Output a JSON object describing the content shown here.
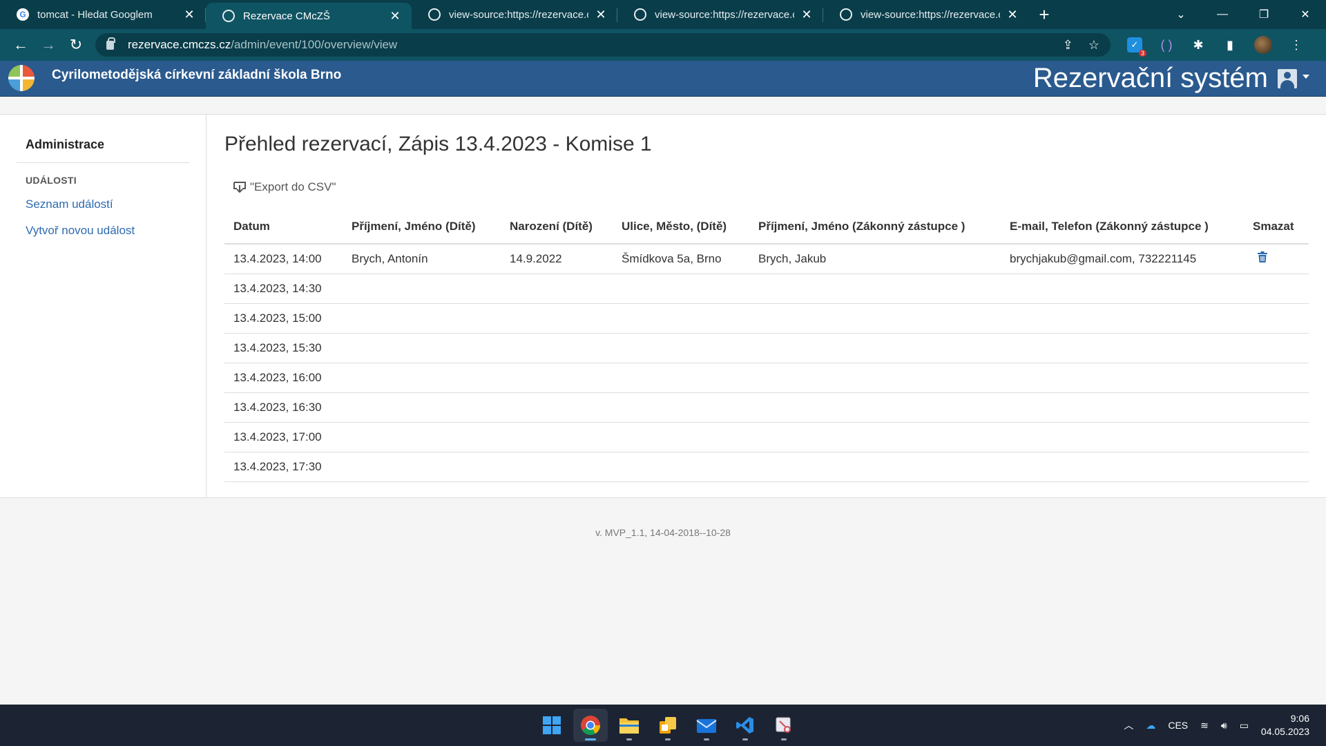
{
  "browser": {
    "tabs": [
      {
        "title": "tomcat - Hledat Googlem",
        "favicon": "google-icon",
        "active": false
      },
      {
        "title": "Rezervace CMcZŠ",
        "favicon": "globe-icon",
        "active": true
      },
      {
        "title": "view-source:https://rezervace.cm",
        "favicon": "globe-icon",
        "active": false
      },
      {
        "title": "view-source:https://rezervace.cm",
        "favicon": "globe-icon",
        "active": false
      },
      {
        "title": "view-source:https://rezervace.cm",
        "favicon": "globe-icon",
        "active": false
      }
    ],
    "url_host": "rezervace.cmczs.cz",
    "url_path": "/admin/event/100/overview/view",
    "extension_badge": "3"
  },
  "header": {
    "school_name": "Cyrilometodějská církevní základní škola Brno",
    "system_title": "Rezervační systém"
  },
  "sidebar": {
    "title": "Administrace",
    "section": "UDÁLOSTI",
    "links": [
      "Seznam událostí",
      "Vytvoř novou událost"
    ]
  },
  "main": {
    "heading": "Přehled rezervací, Zápis 13.4.2023 - Komise 1",
    "export_label": "\"Export do CSV\"",
    "columns": [
      "Datum",
      "Příjmení, Jméno (Dítě)",
      "Narození (Dítě)",
      "Ulice, Město, (Dítě)",
      "Příjmení, Jméno (Zákonný zástupce )",
      "E-mail, Telefon (Zákonný zástupce )",
      "Smazat"
    ],
    "rows": [
      {
        "datum": "13.4.2023, 14:00",
        "child_name": "Brych, Antonín",
        "birth": "14.9.2022",
        "address": "Šmídkova 5a, Brno",
        "guardian": "Brych, Jakub",
        "contact": "brychjakub@gmail.com, 732221145",
        "has_delete": true
      },
      {
        "datum": "13.4.2023, 14:30",
        "child_name": "",
        "birth": "",
        "address": "",
        "guardian": "",
        "contact": "",
        "has_delete": false
      },
      {
        "datum": "13.4.2023, 15:00",
        "child_name": "",
        "birth": "",
        "address": "",
        "guardian": "",
        "contact": "",
        "has_delete": false
      },
      {
        "datum": "13.4.2023, 15:30",
        "child_name": "",
        "birth": "",
        "address": "",
        "guardian": "",
        "contact": "",
        "has_delete": false
      },
      {
        "datum": "13.4.2023, 16:00",
        "child_name": "",
        "birth": "",
        "address": "",
        "guardian": "",
        "contact": "",
        "has_delete": false
      },
      {
        "datum": "13.4.2023, 16:30",
        "child_name": "",
        "birth": "",
        "address": "",
        "guardian": "",
        "contact": "",
        "has_delete": false
      },
      {
        "datum": "13.4.2023, 17:00",
        "child_name": "",
        "birth": "",
        "address": "",
        "guardian": "",
        "contact": "",
        "has_delete": false
      },
      {
        "datum": "13.4.2023, 17:30",
        "child_name": "",
        "birth": "",
        "address": "",
        "guardian": "",
        "contact": "",
        "has_delete": false
      }
    ]
  },
  "footer": {
    "version": "v. MVP_1.1, 14-04-2018--10-28"
  },
  "taskbar": {
    "apps": [
      "start-icon",
      "chrome-icon",
      "file-explorer-icon",
      "office-icon",
      "mail-icon",
      "vscode-icon",
      "snipping-tool-icon"
    ],
    "language": "CES",
    "time": "9:06",
    "date": "04.05.2023"
  },
  "colors": {
    "browser_frame": "#0a3d4a",
    "browser_toolbar": "#0f5463",
    "site_header": "#2a5a8e",
    "link": "#2d6ab0",
    "trash": "#2d6ab0"
  }
}
